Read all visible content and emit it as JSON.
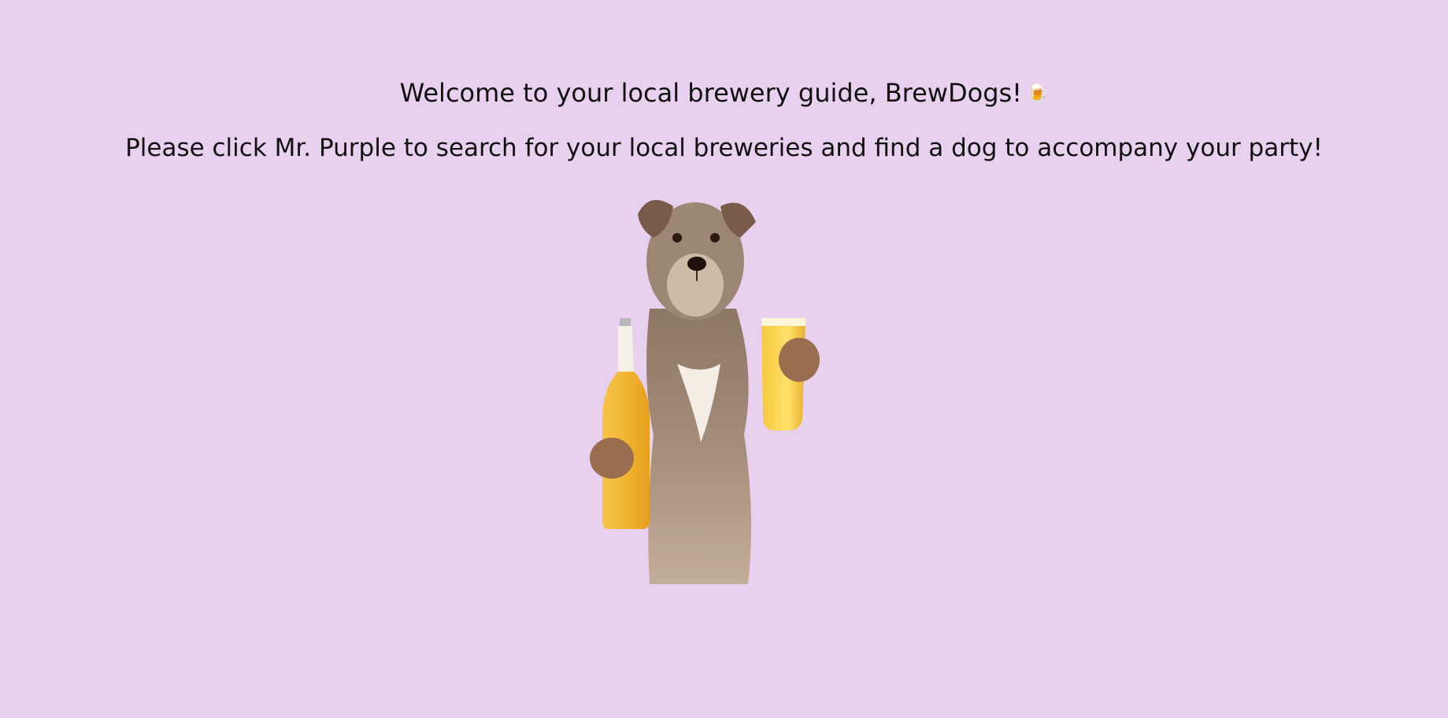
{
  "header": {
    "welcome_text": "Welcome to your local brewery guide, BrewDogs!",
    "welcome_icon": "beer-mug-icon",
    "welcome_icon_glyph": "🍺"
  },
  "main": {
    "instruction_text": "Please click Mr. Purple to search for your local breweries and find a dog to accompany your party!",
    "mascot": {
      "name": "Mr. Purple",
      "icon": "dog-with-beer-image"
    }
  },
  "colors": {
    "background": "#e8d1ee",
    "text": "#111111",
    "beer": "#f2b632",
    "fur": "#a08c78"
  }
}
